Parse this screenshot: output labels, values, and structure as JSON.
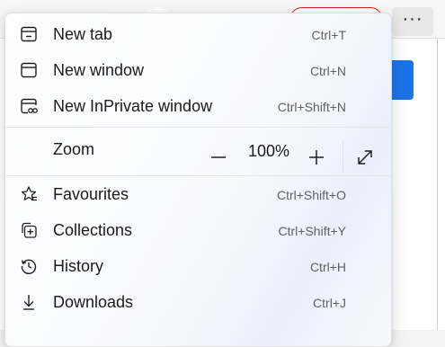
{
  "toolbar": {
    "more_label": "···"
  },
  "menu": {
    "items": [
      {
        "label": "New tab",
        "shortcut": "Ctrl+T",
        "icon": "new-tab-icon"
      },
      {
        "label": "New window",
        "shortcut": "Ctrl+N",
        "icon": "new-window-icon"
      },
      {
        "label": "New InPrivate window",
        "shortcut": "Ctrl+Shift+N",
        "icon": "inprivate-icon"
      }
    ],
    "zoom": {
      "label": "Zoom",
      "value": "100%",
      "decrease": "−",
      "increase": "+",
      "icon": "fullscreen-icon"
    },
    "items2": [
      {
        "label": "Favourites",
        "shortcut": "Ctrl+Shift+O",
        "icon": "favourites-icon"
      },
      {
        "label": "Collections",
        "shortcut": "Ctrl+Shift+Y",
        "icon": "collections-icon"
      },
      {
        "label": "History",
        "shortcut": "Ctrl+H",
        "icon": "history-icon"
      },
      {
        "label": "Downloads",
        "shortcut": "Ctrl+J",
        "icon": "downloads-icon"
      }
    ]
  },
  "colors": {
    "accent": "#1a73e8",
    "alert_outline": "#c42b1c"
  }
}
